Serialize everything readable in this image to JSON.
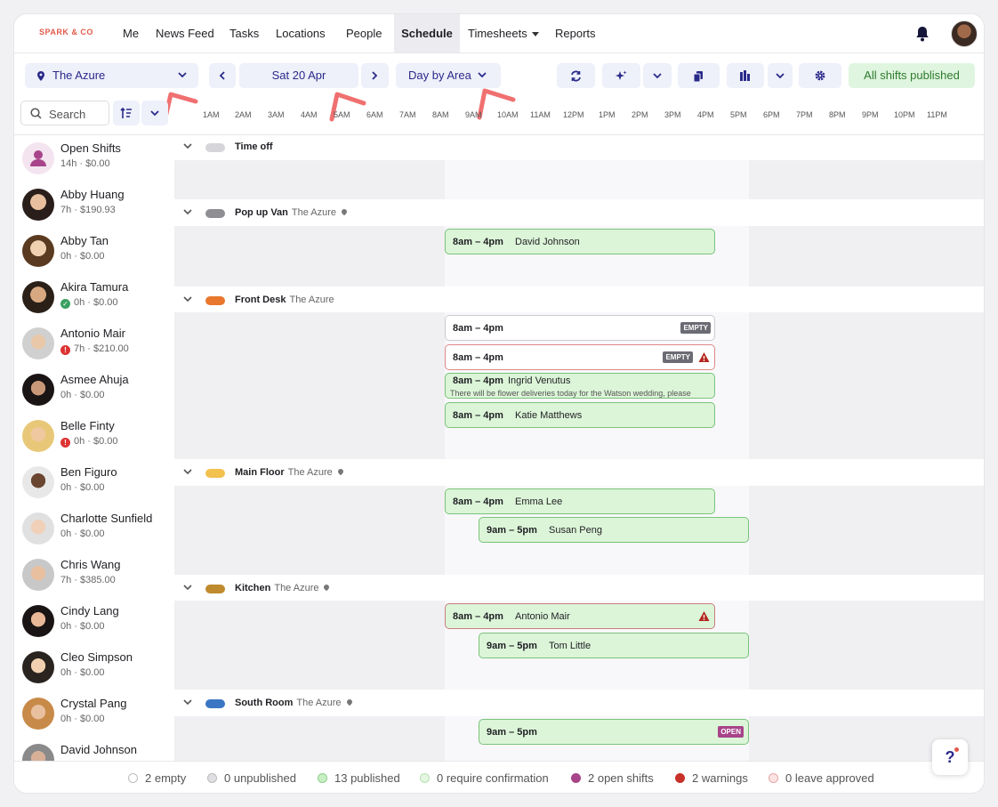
{
  "brand": "SPARK & CO",
  "nav": {
    "items": [
      {
        "label": "Me"
      },
      {
        "label": "News Feed"
      },
      {
        "label": "Tasks"
      },
      {
        "label": "Locations"
      },
      {
        "label": "People"
      },
      {
        "label": "Schedule"
      },
      {
        "label": "Timesheets"
      },
      {
        "label": "Reports"
      }
    ]
  },
  "toolbar": {
    "location": "The Azure",
    "date": "Sat 20 Apr",
    "view": "Day by Area",
    "published": "All shifts published"
  },
  "search": {
    "placeholder": "Search"
  },
  "hours": [
    "1AM",
    "2AM",
    "3AM",
    "4AM",
    "5AM",
    "6AM",
    "7AM",
    "8AM",
    "9AM",
    "10AM",
    "11AM",
    "12PM",
    "1PM",
    "2PM",
    "3PM",
    "4PM",
    "5PM",
    "6PM",
    "7PM",
    "8PM",
    "9PM",
    "10PM",
    "11PM"
  ],
  "people": [
    {
      "name": "Open Shifts",
      "meta": "14h · $0.00",
      "status": ""
    },
    {
      "name": "Abby Huang",
      "meta": "7h · $190.93",
      "status": ""
    },
    {
      "name": "Abby Tan",
      "meta": "0h · $0.00",
      "status": ""
    },
    {
      "name": "Akira Tamura",
      "meta": "0h · $0.00",
      "status": "ok"
    },
    {
      "name": "Antonio Mair",
      "meta": "7h · $210.00",
      "status": "warn"
    },
    {
      "name": "Asmee Ahuja",
      "meta": "0h · $0.00",
      "status": ""
    },
    {
      "name": "Belle Finty",
      "meta": "0h · $0.00",
      "status": "warn"
    },
    {
      "name": "Ben Figuro",
      "meta": "0h · $0.00",
      "status": ""
    },
    {
      "name": "Charlotte Sunfield",
      "meta": "0h · $0.00",
      "status": ""
    },
    {
      "name": "Chris Wang",
      "meta": "7h · $385.00",
      "status": ""
    },
    {
      "name": "Cindy Lang",
      "meta": "0h · $0.00",
      "status": ""
    },
    {
      "name": "Cleo Simpson",
      "meta": "0h · $0.00",
      "status": ""
    },
    {
      "name": "Crystal Pang",
      "meta": "0h · $0.00",
      "status": ""
    },
    {
      "name": "David Johnson",
      "meta": "",
      "status": ""
    }
  ],
  "areas": {
    "timeoff": {
      "name": "Time off",
      "color": "#d6d6da"
    },
    "popup": {
      "name": "Pop up Van",
      "location": "The Azure",
      "color": "#8e8e93"
    },
    "frontdesk": {
      "name": "Front Desk",
      "location": "The Azure",
      "color": "#e8782e"
    },
    "mainfloor": {
      "name": "Main Floor",
      "location": "The Azure",
      "color": "#f2c14e"
    },
    "kitchen": {
      "name": "Kitchen",
      "location": "The Azure",
      "color": "#c08a2e"
    },
    "southroom": {
      "name": "South Room",
      "location": "The Azure",
      "color": "#3a76c4"
    }
  },
  "shifts": {
    "popup1": {
      "time": "8am – 4pm",
      "name": "David Johnson"
    },
    "fd1": {
      "time": "8am – 4pm",
      "tag": "EMPTY"
    },
    "fd2": {
      "time": "8am – 4pm",
      "tag": "EMPTY"
    },
    "fd3": {
      "time": "8am – 4pm",
      "name": "Ingrid Venutus",
      "note": "There will be flower deliveries today for the Watson wedding, please"
    },
    "fd4": {
      "time": "8am – 4pm",
      "name": "Katie Matthews"
    },
    "mf1": {
      "time": "8am – 4pm",
      "name": "Emma Lee"
    },
    "mf2": {
      "time": "9am – 5pm",
      "name": "Susan Peng"
    },
    "k1": {
      "time": "8am – 4pm",
      "name": "Antonio Mair"
    },
    "k2": {
      "time": "9am – 5pm",
      "name": "Tom Little"
    },
    "sr1": {
      "time": "9am – 5pm",
      "tag": "OPEN"
    }
  },
  "footer": [
    {
      "label": "2 empty",
      "color": "#ffffff"
    },
    {
      "label": "0 unpublished",
      "color": "#e0e0e4"
    },
    {
      "label": "13 published",
      "color": "#c8efc4"
    },
    {
      "label": "0 require confirmation",
      "color": "#e6f6e3"
    },
    {
      "label": "2 open shifts",
      "color": "#a8448a"
    },
    {
      "label": "2 warnings",
      "color": "#c8302a"
    },
    {
      "label": "0 leave approved",
      "color": "#fde4e4"
    }
  ],
  "help": "?"
}
